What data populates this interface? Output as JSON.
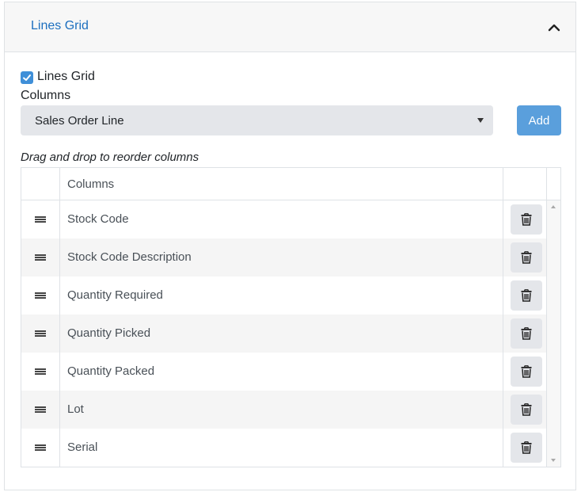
{
  "panel": {
    "title": "Lines Grid",
    "collapse_icon": "chevron-up-icon"
  },
  "lines_grid_checkbox": {
    "label": "Lines Grid",
    "checked": true
  },
  "columns_section": {
    "label": "Columns",
    "select_value": "Sales Order Line",
    "add_label": "Add",
    "hint": "Drag and drop to reorder columns"
  },
  "grid": {
    "header": "Columns",
    "rows": [
      {
        "label": "Stock Code"
      },
      {
        "label": "Stock Code Description"
      },
      {
        "label": "Quantity Required"
      },
      {
        "label": "Quantity Picked"
      },
      {
        "label": "Quantity Packed"
      },
      {
        "label": "Lot"
      },
      {
        "label": "Serial"
      }
    ]
  },
  "colors": {
    "accent": "#1d6fbf",
    "checkbox": "#3f8fd8",
    "add_button": "#5a9fdc",
    "select_bg": "#e4e6ea"
  }
}
